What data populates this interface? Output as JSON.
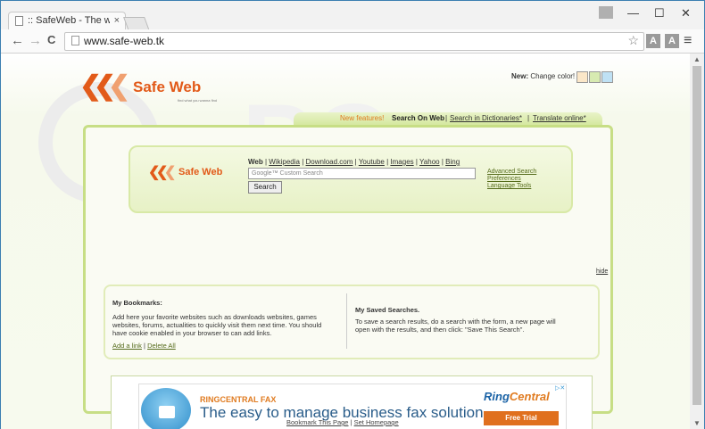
{
  "browser": {
    "tab_title": ":: SafeWeb - The web neve",
    "tab_close": "×",
    "url": "www.safe-web.tk",
    "window_controls": {
      "minimize": "—",
      "maximize": "☐",
      "close": "✕"
    },
    "nav": {
      "back": "←",
      "forward": "→",
      "reload": "C"
    },
    "extensions": [
      "A",
      "A"
    ],
    "menu_icon": "≡"
  },
  "page": {
    "logo_text": "Safe Web",
    "logo_tagline": "find what you wanna find",
    "new_color": {
      "label_bold": "New:",
      "label": " Change color!",
      "swatches": [
        "#fbe7c8",
        "#d7eab1",
        "#bfe1f4"
      ]
    },
    "tabs": {
      "new_features": "New features!",
      "search_on_web": "Search On Web",
      "dictionaries": "Search in Dictionaries*",
      "translate": "Translate online*"
    },
    "search": {
      "engines_active": "Web",
      "engines": [
        "Wikipedia",
        "Download.com",
        "Youtube",
        "Images",
        "Yahoo",
        "Bing"
      ],
      "placeholder": "Google™ Custom Search",
      "button": "Search",
      "links": [
        "Advanced Search",
        "Preferences",
        "Language Tools"
      ]
    },
    "hide_link": "hide",
    "bookmarks": {
      "title": "My Bookmarks:",
      "text": "Add here your favorite websites such as downloads websites, games websites, forums, actualities to quickly visit them next time. You should have cookie enabled in your browser to can add links.",
      "add_link": "Add a link",
      "delete_all": "Delete All"
    },
    "saved_searches": {
      "title": "My Saved Searches.",
      "text": "To save a search results, do a search with the form, a new page will open with the results, and then click: \"Save This Search\"."
    },
    "ad": {
      "headline": "RINGCENTRAL FAX",
      "tagline": "The easy to manage business fax solution",
      "brand_a": "Ring",
      "brand_b": "Central",
      "cta": "Free Trial",
      "ad_marker": "▷✕"
    },
    "footer": {
      "bookmark": "Bookmark This Page",
      "sep": " | ",
      "homepage": "Set Homepage"
    }
  }
}
